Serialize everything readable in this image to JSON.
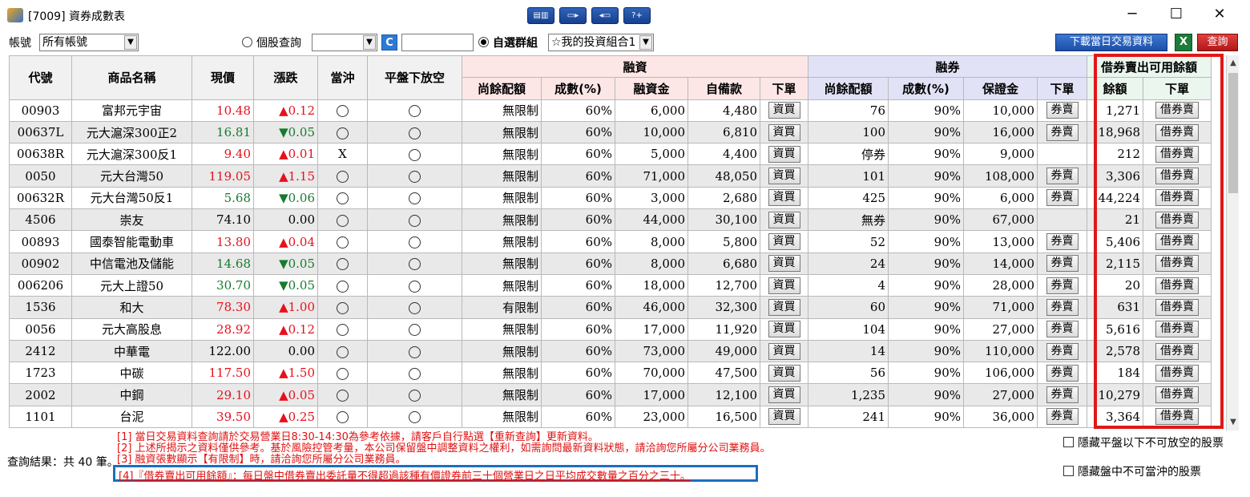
{
  "window": {
    "title": "[7009] 資券成數表"
  },
  "toolbar": {
    "account_label": "帳號",
    "account_value": "所有帳號",
    "single_query_label": "個股查詢",
    "group_label": "自選群組",
    "group_value": "☆我的投資組合1",
    "download_label": "下載當日交易資料",
    "excel_label": "X",
    "query_label": "查詢",
    "refresh_label": "C"
  },
  "table": {
    "headers": {
      "code": "代號",
      "name": "商品名稱",
      "price": "現價",
      "change": "漲跌",
      "daytrade": "當沖",
      "short_below": "平盤下放空",
      "margin_group": "融資",
      "short_group": "融券",
      "sbl_group": "借券賣出可用餘額",
      "m_quota": "尚餘配額",
      "m_pct": "成數(%)",
      "m_amount": "融資金",
      "m_self": "自備款",
      "m_order": "下單",
      "s_quota": "尚餘配額",
      "s_pct": "成數(%)",
      "s_deposit": "保證金",
      "s_order": "下單",
      "b_balance": "餘額",
      "b_order": "下單"
    },
    "rows": [
      {
        "code": "00903",
        "name": "富邦元宇宙",
        "price": "10.48",
        "change": "▲0.12",
        "dir": "up",
        "daytrade": "○",
        "m_quota": "無限制",
        "m_pct": "60%",
        "m_amount": "6,000",
        "m_self": "4,480",
        "m_btn": "資買",
        "s_quota": "76",
        "s_pct": "90%",
        "s_deposit": "10,000",
        "s_btn": "券賣",
        "b_balance": "1,271",
        "b_btn": "借券賣"
      },
      {
        "code": "00637L",
        "name": "元大滬深300正2",
        "price": "16.81",
        "change": "▼0.05",
        "dir": "down",
        "daytrade": "○",
        "m_quota": "無限制",
        "m_pct": "60%",
        "m_amount": "10,000",
        "m_self": "6,810",
        "m_btn": "資買",
        "s_quota": "100",
        "s_pct": "90%",
        "s_deposit": "16,000",
        "s_btn": "券賣",
        "b_balance": "18,968",
        "b_btn": "借券賣"
      },
      {
        "code": "00638R",
        "name": "元大滬深300反1",
        "price": "9.40",
        "change": "▲0.01",
        "dir": "up",
        "daytrade": "X",
        "m_quota": "無限制",
        "m_pct": "60%",
        "m_amount": "5,000",
        "m_self": "4,400",
        "m_btn": "資買",
        "s_quota": "停券",
        "s_pct": "90%",
        "s_deposit": "9,000",
        "s_btn": "",
        "b_balance": "212",
        "b_btn": "借券賣"
      },
      {
        "code": "0050",
        "name": "元大台灣50",
        "price": "119.05",
        "change": "▲1.15",
        "dir": "up",
        "daytrade": "○",
        "m_quota": "無限制",
        "m_pct": "60%",
        "m_amount": "71,000",
        "m_self": "48,050",
        "m_btn": "資買",
        "s_quota": "101",
        "s_pct": "90%",
        "s_deposit": "108,000",
        "s_btn": "券賣",
        "b_balance": "3,306",
        "b_btn": "借券賣"
      },
      {
        "code": "00632R",
        "name": "元大台灣50反1",
        "price": "5.68",
        "change": "▼0.06",
        "dir": "down",
        "daytrade": "○",
        "m_quota": "無限制",
        "m_pct": "60%",
        "m_amount": "3,000",
        "m_self": "2,680",
        "m_btn": "資買",
        "s_quota": "425",
        "s_pct": "90%",
        "s_deposit": "6,000",
        "s_btn": "券賣",
        "b_balance": "44,224",
        "b_btn": "借券賣"
      },
      {
        "code": "4506",
        "name": "崇友",
        "price": "74.10",
        "change": "0.00",
        "dir": "flat",
        "daytrade": "○",
        "m_quota": "無限制",
        "m_pct": "60%",
        "m_amount": "44,000",
        "m_self": "30,100",
        "m_btn": "資買",
        "s_quota": "無券",
        "s_pct": "90%",
        "s_deposit": "67,000",
        "s_btn": "",
        "b_balance": "21",
        "b_btn": "借券賣"
      },
      {
        "code": "00893",
        "name": "國泰智能電動車",
        "price": "13.80",
        "change": "▲0.04",
        "dir": "up",
        "daytrade": "○",
        "m_quota": "無限制",
        "m_pct": "60%",
        "m_amount": "8,000",
        "m_self": "5,800",
        "m_btn": "資買",
        "s_quota": "52",
        "s_pct": "90%",
        "s_deposit": "13,000",
        "s_btn": "券賣",
        "b_balance": "5,406",
        "b_btn": "借券賣"
      },
      {
        "code": "00902",
        "name": "中信電池及儲能",
        "price": "14.68",
        "change": "▼0.05",
        "dir": "down",
        "daytrade": "○",
        "m_quota": "無限制",
        "m_pct": "60%",
        "m_amount": "8,000",
        "m_self": "6,680",
        "m_btn": "資買",
        "s_quota": "24",
        "s_pct": "90%",
        "s_deposit": "14,000",
        "s_btn": "券賣",
        "b_balance": "2,115",
        "b_btn": "借券賣"
      },
      {
        "code": "006206",
        "name": "元大上證50",
        "price": "30.70",
        "change": "▼0.05",
        "dir": "down",
        "daytrade": "○",
        "m_quota": "無限制",
        "m_pct": "60%",
        "m_amount": "18,000",
        "m_self": "12,700",
        "m_btn": "資買",
        "s_quota": "4",
        "s_pct": "90%",
        "s_deposit": "28,000",
        "s_btn": "券賣",
        "b_balance": "20",
        "b_btn": "借券賣"
      },
      {
        "code": "1536",
        "name": "和大",
        "price": "78.30",
        "change": "▲1.00",
        "dir": "up",
        "daytrade": "○",
        "m_quota": "有限制",
        "m_pct": "60%",
        "m_amount": "46,000",
        "m_self": "32,300",
        "m_btn": "資買",
        "s_quota": "60",
        "s_pct": "90%",
        "s_deposit": "71,000",
        "s_btn": "券賣",
        "b_balance": "631",
        "b_btn": "借券賣"
      },
      {
        "code": "0056",
        "name": "元大高股息",
        "price": "28.92",
        "change": "▲0.12",
        "dir": "up",
        "daytrade": "○",
        "m_quota": "無限制",
        "m_pct": "60%",
        "m_amount": "17,000",
        "m_self": "11,920",
        "m_btn": "資買",
        "s_quota": "104",
        "s_pct": "90%",
        "s_deposit": "27,000",
        "s_btn": "券賣",
        "b_balance": "5,616",
        "b_btn": "借券賣"
      },
      {
        "code": "2412",
        "name": "中華電",
        "price": "122.00",
        "change": "0.00",
        "dir": "flat",
        "daytrade": "○",
        "m_quota": "無限制",
        "m_pct": "60%",
        "m_amount": "73,000",
        "m_self": "49,000",
        "m_btn": "資買",
        "s_quota": "14",
        "s_pct": "90%",
        "s_deposit": "110,000",
        "s_btn": "券賣",
        "b_balance": "2,578",
        "b_btn": "借券賣"
      },
      {
        "code": "1723",
        "name": "中碳",
        "price": "117.50",
        "change": "▲1.50",
        "dir": "up",
        "daytrade": "○",
        "m_quota": "無限制",
        "m_pct": "60%",
        "m_amount": "70,000",
        "m_self": "47,500",
        "m_btn": "資買",
        "s_quota": "56",
        "s_pct": "90%",
        "s_deposit": "106,000",
        "s_btn": "券賣",
        "b_balance": "184",
        "b_btn": "借券賣"
      },
      {
        "code": "2002",
        "name": "中鋼",
        "price": "29.10",
        "change": "▲0.05",
        "dir": "up",
        "daytrade": "○",
        "m_quota": "無限制",
        "m_pct": "60%",
        "m_amount": "17,000",
        "m_self": "12,100",
        "m_btn": "資買",
        "s_quota": "1,235",
        "s_pct": "90%",
        "s_deposit": "27,000",
        "s_btn": "券賣",
        "b_balance": "10,279",
        "b_btn": "借券賣"
      },
      {
        "code": "1101",
        "name": "台泥",
        "price": "39.50",
        "change": "▲0.25",
        "dir": "up",
        "daytrade": "○",
        "m_quota": "無限制",
        "m_pct": "60%",
        "m_amount": "23,000",
        "m_self": "16,500",
        "m_btn": "資買",
        "s_quota": "241",
        "s_pct": "90%",
        "s_deposit": "36,000",
        "s_btn": "券賣",
        "b_balance": "3,364",
        "b_btn": "借券賣"
      }
    ]
  },
  "notes": [
    "[1] 當日交易資料查詢請於交易營業日8:30-14:30為參考依據，請客戶自行點選【重新查詢】更新資料。",
    "[2] 上述所揭示之資料僅供參考。基於風險控管考量，本公司保留盤中調整資料之權利，如需詢問最新資料狀態，請洽詢您所屬分公司業務員。",
    "[3] 融資張數顯示【有限制】時，請洽詢您所屬分公司業務員。",
    "[4]『借券賣出可用餘額』：每日盤中借券賣出委託量不得超過該種有價證券前三十個營業日之日平均成交數量之百分之三十。"
  ],
  "footer": {
    "result": "查詢結果：共 40 筆。",
    "hide_below_flat": "隱藏平盤以下不可放空的股票",
    "hide_no_daytrade": "隱藏盤中不可當沖的股票"
  },
  "colors": {
    "up": "#e8101c",
    "down": "#177a2e",
    "highlight_frame": "#e01818",
    "note_frame": "#1a6fc0"
  }
}
